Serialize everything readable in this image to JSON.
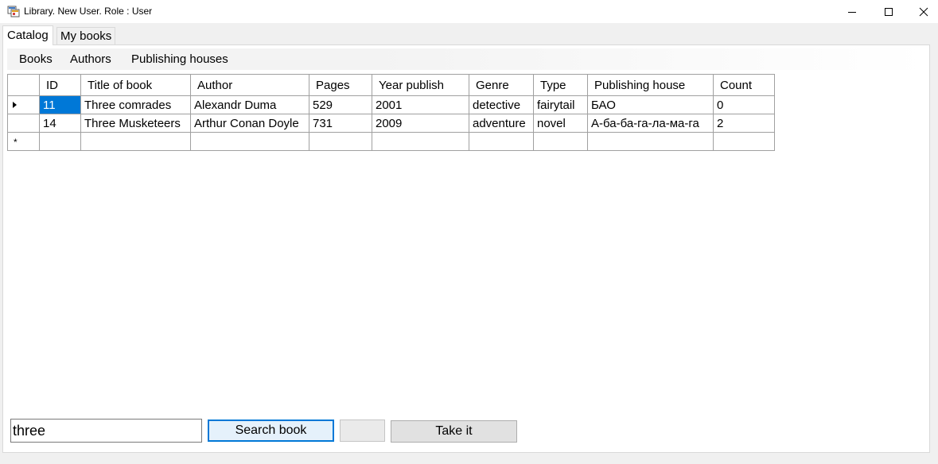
{
  "window": {
    "title": "Library. New User. Role : User",
    "icon": "app-icon",
    "controls": [
      "minimize-icon",
      "maximize-icon",
      "close-icon"
    ]
  },
  "tabs": [
    {
      "label": "Catalog",
      "selected": true
    },
    {
      "label": "My books",
      "selected": false
    }
  ],
  "menu": {
    "items": [
      "Books",
      "Authors",
      "Publishing houses"
    ]
  },
  "grid": {
    "columns": [
      "ID",
      "Title of book",
      "Author",
      "Pages",
      "Year publish",
      "Genre",
      "Type",
      "Publishing house",
      "Count"
    ],
    "rows": [
      [
        "11",
        "Three comrades",
        "Alexandr Duma",
        "529",
        "2001",
        "detective",
        "fairytail",
        "БАО",
        "0"
      ],
      [
        "14",
        "Three Musketeers",
        "Arthur Conan Doyle",
        "731",
        "2009",
        "adventure",
        "novel",
        "А-ба-ба-га-ла-ма-га",
        "2"
      ]
    ],
    "current_row_marker": "row-arrow-icon",
    "new_row_marker": "*",
    "selection_color": "#0078d7"
  },
  "search": {
    "value": "three",
    "button_label": "Search book"
  },
  "actions": {
    "blank_label": "",
    "take_label": "Take it"
  }
}
